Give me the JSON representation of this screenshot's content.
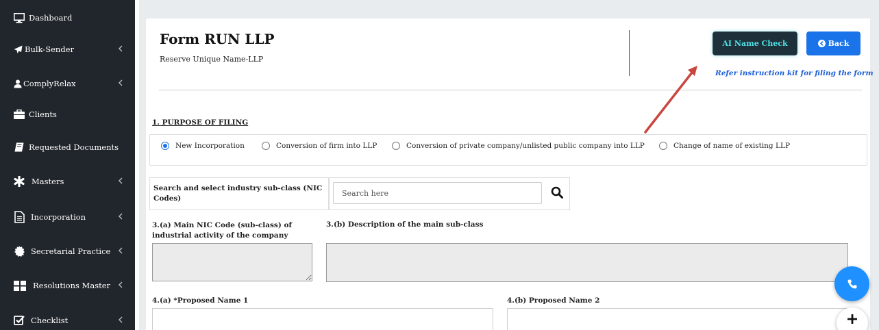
{
  "sidebar": {
    "items": [
      {
        "label": "Dashboard",
        "icon": "monitor-icon",
        "has_chevron": false
      },
      {
        "label": "Bulk-Sender",
        "icon": "paper-plane-icon",
        "has_chevron": true
      },
      {
        "label": "ComplyRelax",
        "icon": "user-icon",
        "has_chevron": true
      },
      {
        "label": "Clients",
        "icon": "briefcase-icon",
        "has_chevron": false
      },
      {
        "label": "Requested Documents",
        "icon": "book-icon",
        "has_chevron": false
      },
      {
        "label": "Masters",
        "icon": "asterisk-icon",
        "has_chevron": true
      },
      {
        "label": "Incorporation",
        "icon": "document-icon",
        "has_chevron": true
      },
      {
        "label": "Secretarial Practice",
        "icon": "certificate-icon",
        "has_chevron": true
      },
      {
        "label": "Resolutions Master",
        "icon": "grid-icon",
        "has_chevron": true
      },
      {
        "label": "Checklist",
        "icon": "checkbox-icon",
        "has_chevron": true
      }
    ]
  },
  "header": {
    "title": "Form RUN LLP",
    "subtitle": "Reserve Unique Name-LLP",
    "ai_button_label": "AI Name Check",
    "back_button_label": "Back",
    "instruction_link": "Refer instruction kit for filing the form"
  },
  "purpose": {
    "title": "1. PURPOSE OF FILING",
    "options": [
      {
        "label": "New Incorporation",
        "selected": true
      },
      {
        "label": "Conversion of firm into LLP",
        "selected": false
      },
      {
        "label": "Conversion of private company/unlisted public company into LLP",
        "selected": false
      },
      {
        "label": "Change of name of existing LLP",
        "selected": false
      }
    ]
  },
  "industry": {
    "search_label": "Search and select industry sub-class (NIC Codes)",
    "search_placeholder": "Search here",
    "nic_code_label": "3.(a) Main NIC Code (sub-class) of industrial activity of the company",
    "description_label": "3.(b) Description of the main sub-class"
  },
  "names": {
    "proposed_1_label": "4.(a) *Proposed Name 1",
    "proposed_2_label": "4.(b) Proposed Name 2"
  },
  "colors": {
    "sidebar_bg": "#21262c",
    "accent_blue": "#1a73e8",
    "ai_button_bg": "#1e3039",
    "ai_button_text": "#4ee0e6",
    "arrow": "#c9463f"
  }
}
